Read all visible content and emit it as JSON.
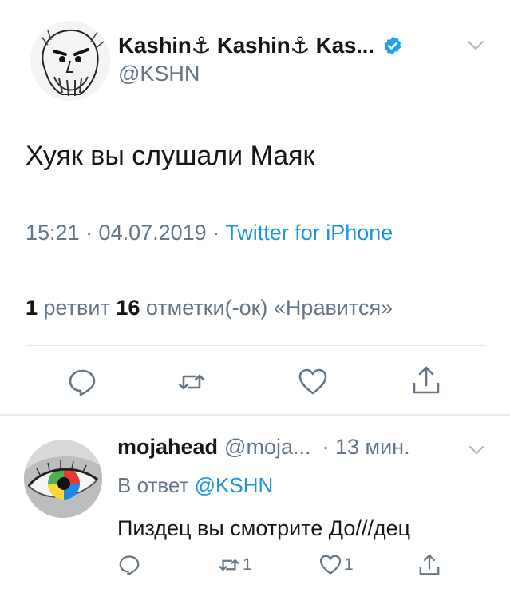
{
  "tweet": {
    "display_name": "Kashin⚓ Kashin⚓ Kas...",
    "handle": "@KSHN",
    "text": "Хуяк вы слушали Маяк",
    "time": "15:21 · 04.07.2019 · ",
    "source": "Twitter for iPhone",
    "retweets_count": "1",
    "retweets_label": " ретвит ",
    "likes_count": "16",
    "likes_label": " отметки(-ок) «Нравится»"
  },
  "reply": {
    "display_name": "mojahead",
    "handle": "@moja...",
    "time": "· 13 мин.",
    "reply_to_label": "В ответ ",
    "reply_to_mention": "@KSHN",
    "text": "Пиздец вы смотрите До///дец",
    "retweet_count": "1",
    "like_count": "1"
  },
  "icons": {
    "verified": "verified-badge-icon",
    "caret": "chevron-down-icon",
    "reply": "reply-icon",
    "retweet": "retweet-icon",
    "like": "heart-icon",
    "share": "share-icon"
  },
  "colors": {
    "text": "#14171a",
    "muted": "#657786",
    "link": "#1b95e0",
    "verified": "#1da1f2",
    "divider": "#e1e8ed"
  }
}
